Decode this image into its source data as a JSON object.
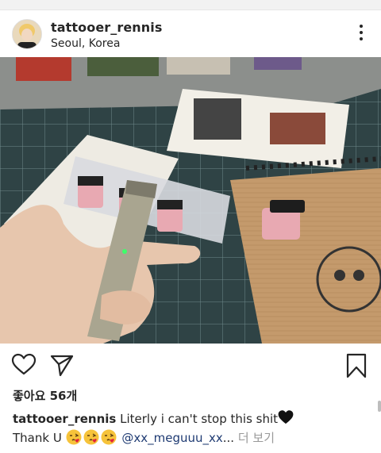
{
  "post": {
    "username": "tattooer_rennis",
    "location": "Seoul, Korea",
    "likes_text": "좋아요 56개",
    "caption_user": "tattooer_rennis",
    "caption_text": "Literly i can't stop this shit",
    "caption_line2_text": "Thank U",
    "mention": "@xx_meguuu_xx",
    "ellipsis": "...",
    "more_label": "더 보기"
  },
  "icons": {
    "more": "more-vertical-icon",
    "like": "heart-icon",
    "share": "send-icon",
    "save": "bookmark-icon",
    "black_heart": "black-heart-emoji",
    "kiss_emoji": "face-blowing-kiss-emoji"
  },
  "colors": {
    "text": "#262626",
    "mention": "#1e3a72",
    "muted": "#999999"
  }
}
